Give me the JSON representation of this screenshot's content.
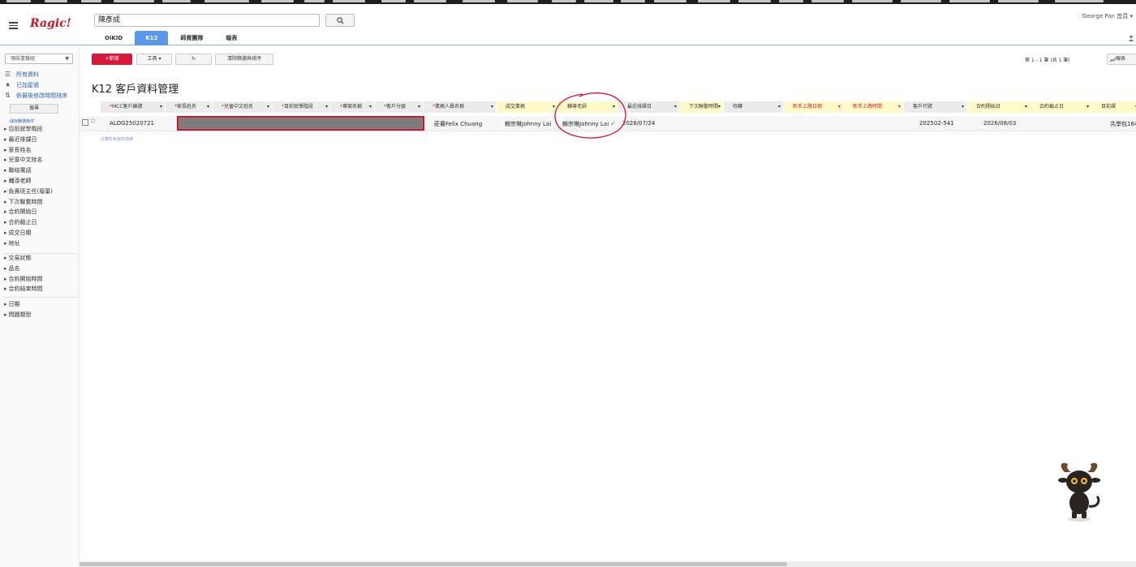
{
  "app": {
    "logo": "Ragic!",
    "user": "George Pan 首頁"
  },
  "search": {
    "value": "陳彥成",
    "button": "🔍"
  },
  "tabs": [
    {
      "label": "OiKID",
      "active": false
    },
    {
      "label": "K12",
      "active": true
    },
    {
      "label": "師資團隊",
      "active": false
    },
    {
      "label": "報表",
      "active": false
    }
  ],
  "sidebar": {
    "view_select": "預設書籤組",
    "links": [
      "所有資料",
      "已加星號",
      "依最後修改時間排序"
    ],
    "search_button": "搜尋",
    "save_filter": "儲存篩選條件",
    "filters_group1": [
      "目前就學階段",
      "最近排課日",
      "家長姓名",
      "兒童中文姓名",
      "聯絡電話",
      "輔導老師",
      "負責班主任(廢棄)",
      "下次聯繫時間",
      "合約開始日",
      "合約截止日",
      "成交日期",
      "地址"
    ],
    "filters_group2": [
      "交易狀態",
      "品名",
      "合約開始時間",
      "合約結束時間"
    ],
    "filters_group3": [
      "日期",
      "問題類型"
    ]
  },
  "toolbar": {
    "new_label": "+新增",
    "tools_label": "工具 ▾",
    "refresh_label": "↻",
    "clear_label": "清除篩選與排序",
    "page_info": "第 1 - 1 筆 (共 1 筆)",
    "report_label": "報表"
  },
  "page_title": "K12 客戶資料管理",
  "columns": [
    {
      "label": "MCC客戶編號",
      "required": true,
      "style": "grey"
    },
    {
      "label": "家長姓名",
      "required": true,
      "style": "grey"
    },
    {
      "label": "兒童中文姓名",
      "required": true,
      "style": "grey"
    },
    {
      "label": "目前就學階段",
      "required": true,
      "style": "grey"
    },
    {
      "label": "專案名稱",
      "required": true,
      "style": "grey"
    },
    {
      "label": "客戶分級",
      "required": true,
      "style": "grey"
    },
    {
      "label": "業務人員名稱",
      "required": true,
      "style": "grey"
    },
    {
      "label": "成交業務",
      "required": false,
      "style": "yellow"
    },
    {
      "label": "輔導老師",
      "required": false,
      "style": "yellow"
    },
    {
      "label": "最近排課日",
      "required": false,
      "style": "grey"
    },
    {
      "label": "下次聯繫時間",
      "required": false,
      "style": "yellow"
    },
    {
      "label": "待轉",
      "required": false,
      "style": "grey"
    },
    {
      "label": "新手上路日期",
      "required": false,
      "style": "yellow-red"
    },
    {
      "label": "新手上路時間",
      "required": false,
      "style": "yellow-red"
    },
    {
      "label": "客戶代號",
      "required": false,
      "style": "grey"
    },
    {
      "label": "合約開始日",
      "required": false,
      "style": "yellow"
    },
    {
      "label": "合約截止日",
      "required": false,
      "style": "yellow"
    },
    {
      "label": "目前課",
      "required": false,
      "style": "yellow"
    }
  ],
  "row": {
    "mcc_id": "ALOG25020721",
    "sales_person": "莊蕎Felix Chuang",
    "deal_sales": "賴宗琳Johnny Lai",
    "tutor": "賴宗琳Johnny Lai",
    "tutor_check": "✓",
    "last_class_date": "2026/07/24",
    "customer_code": "202502-541",
    "contract_start": "2026/08/03",
    "current_course": "共學包164"
  },
  "table_note": "計算所有資料加總",
  "colors": {
    "accent": "#5b97e8",
    "brand": "#d01029",
    "highlight": "#d6102a"
  }
}
